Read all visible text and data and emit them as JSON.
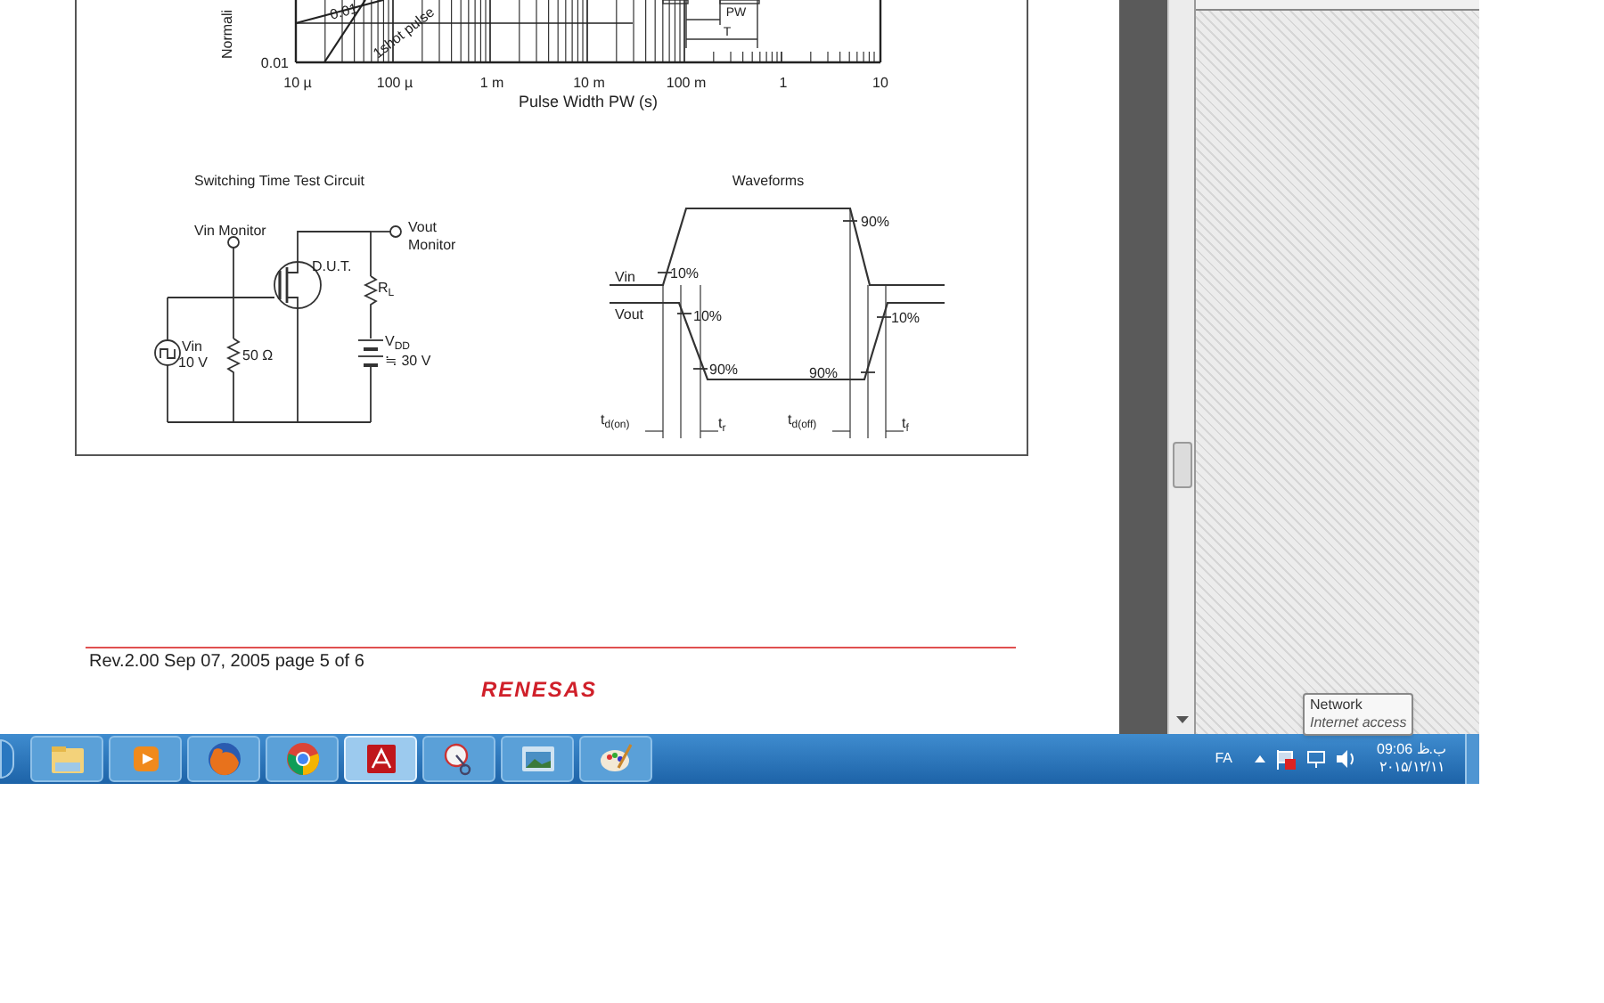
{
  "document": {
    "chart": {
      "y_axis_label": "Normali",
      "y_tick_label": "0.01",
      "x_tick_labels": [
        "10 µ",
        "100 µ",
        "1 m",
        "10 m",
        "100 m",
        "1",
        "10"
      ],
      "x_axis_label": "Pulse Width  PW  (s)",
      "curve_labels": [
        "0.01",
        "1shot pulse"
      ],
      "inset_labels": [
        "PW",
        "T"
      ]
    },
    "circuit": {
      "title": "Switching Time Test Circuit",
      "vin_monitor": "Vin Monitor",
      "vout_monitor": [
        "Vout",
        "Monitor"
      ],
      "dut": "D.U.T.",
      "load_resistor": {
        "main": "R",
        "sub": "L"
      },
      "source": [
        "Vin",
        "10 V"
      ],
      "resistor": "50 Ω",
      "supply": {
        "main": "V",
        "sub": "DD"
      },
      "supply_value": "≒ 30 V"
    },
    "waveforms": {
      "title": "Waveforms",
      "vin": "Vin",
      "vout": "Vout",
      "marks": [
        "10%",
        "90%",
        "10%",
        "90%",
        "90%",
        "10%"
      ],
      "times": [
        {
          "main": "t",
          "sub": "d(on)"
        },
        {
          "main": "t",
          "sub": "r"
        },
        {
          "main": "t",
          "sub": "d(off)"
        },
        {
          "main": "t",
          "sub": "f"
        }
      ]
    },
    "footer": {
      "text": "Rev.2.00  Sep 07, 2005  page 5 of 6",
      "logo": "RENESAS"
    }
  },
  "tooltip": {
    "title": "Network",
    "subtitle": "Internet access"
  },
  "taskbar": {
    "items": [
      {
        "kind": "folder",
        "selected": false
      },
      {
        "kind": "media",
        "selected": false
      },
      {
        "kind": "firefox",
        "selected": false
      },
      {
        "kind": "chrome",
        "selected": false
      },
      {
        "kind": "pdf",
        "selected": true
      },
      {
        "kind": "snip",
        "selected": false
      },
      {
        "kind": "photo",
        "selected": false
      },
      {
        "kind": "paint",
        "selected": false
      }
    ],
    "language": "FA",
    "time": "09:06 ب.ظ",
    "date": "۲۰۱۵/۱۲/۱۱"
  }
}
